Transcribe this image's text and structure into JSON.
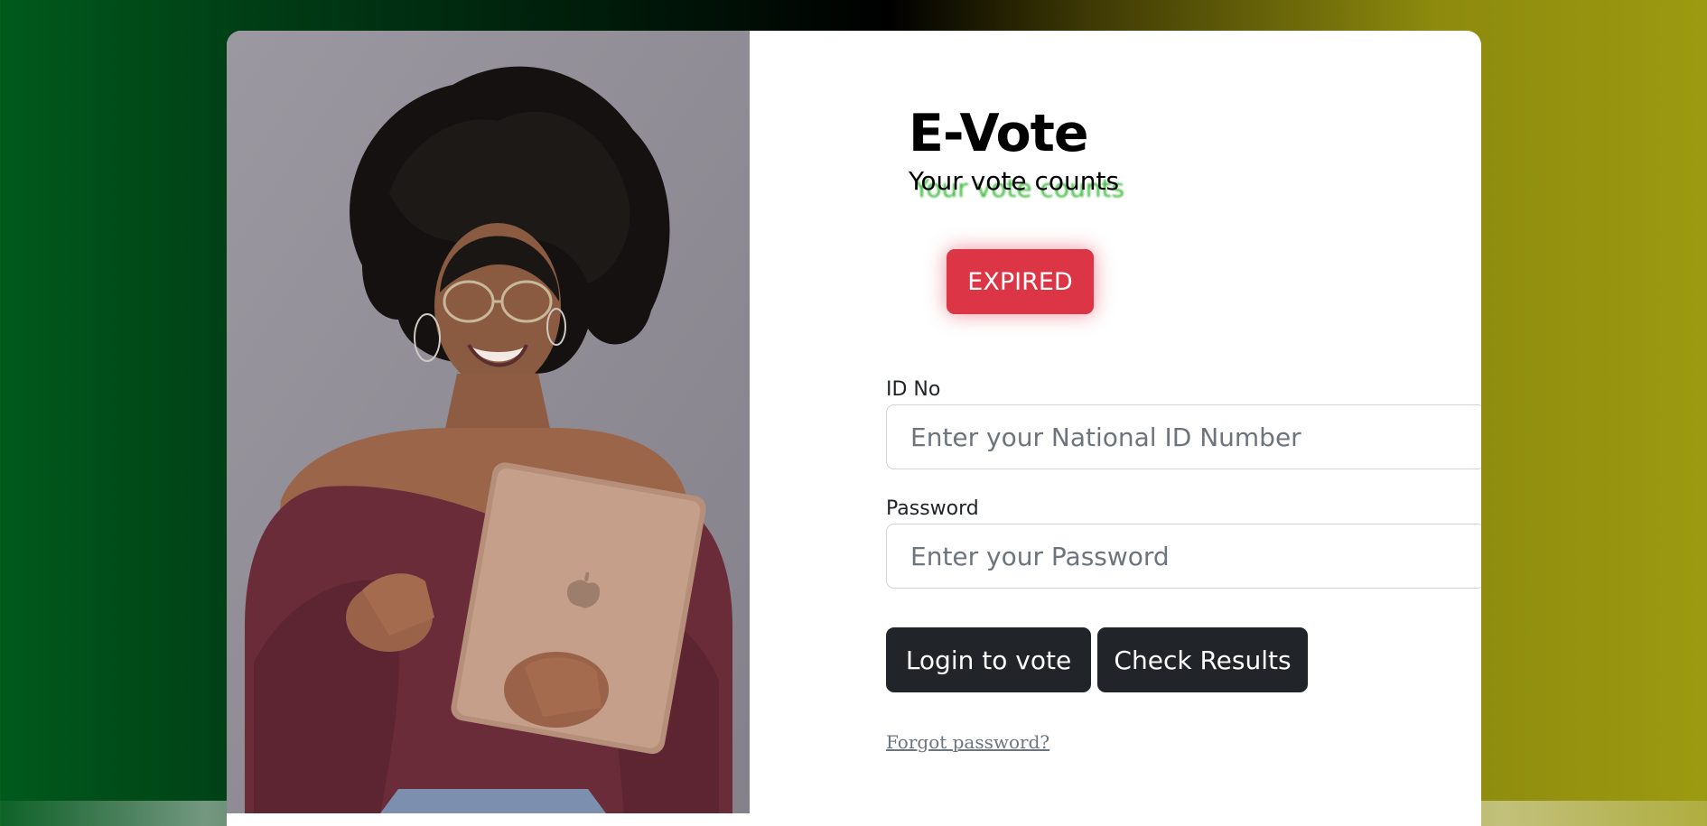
{
  "brand": {
    "title": "E-Vote",
    "subtitle": "Your vote counts"
  },
  "status": {
    "badge": "EXPIRED",
    "badge_color": "#dc3545"
  },
  "form": {
    "id_label": "ID No",
    "id_placeholder": "Enter your National ID Number",
    "id_value": "",
    "password_label": "Password",
    "password_placeholder": "Enter your Password",
    "password_value": ""
  },
  "actions": {
    "login_label": "Login to vote",
    "results_label": "Check Results",
    "forgot_label": "Forgot password?"
  },
  "colors": {
    "background_left": "#005a1c",
    "background_mid": "#000000",
    "background_right": "#9c9a10",
    "button": "#212529",
    "subtitle_shadow": "#3db83d"
  },
  "hero_image": {
    "icon": "woman-with-tablet-photo"
  }
}
